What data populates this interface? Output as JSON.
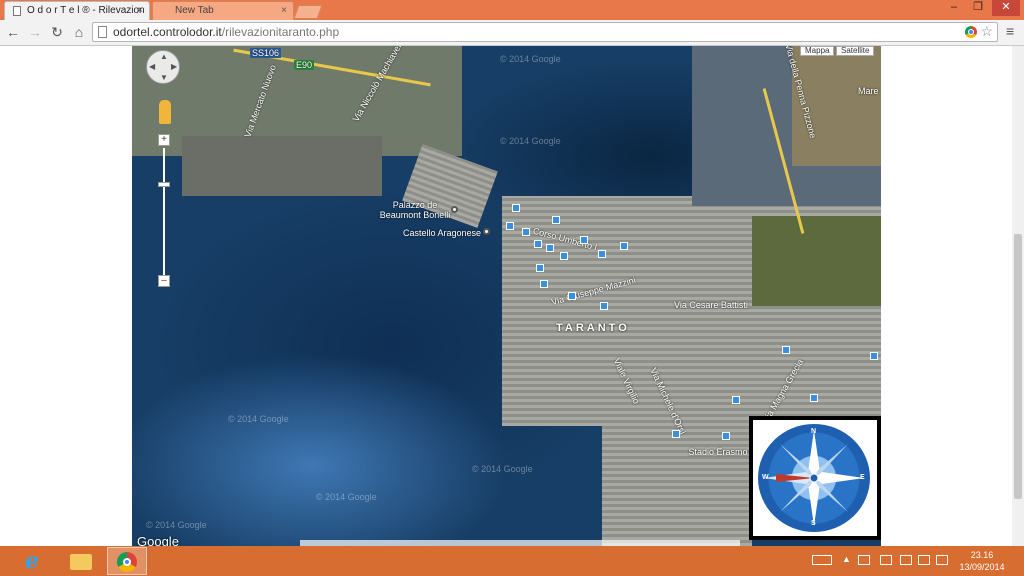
{
  "browser": {
    "tabs": [
      {
        "label": "O d o r T e l ® - Rilevazion"
      },
      {
        "label": "New Tab"
      }
    ],
    "url_host": "odortel.controlodor.it",
    "url_path": "/rilevazionitaranto.php",
    "window_controls": {
      "minimize": "–",
      "restore": "❐",
      "close": "✕"
    },
    "close_tab": "×"
  },
  "map": {
    "type_buttons": [
      "Mappa",
      "Satellite"
    ],
    "city_label": "TARANTO",
    "streets": [
      "SS106",
      "E90",
      "Via Niccolò Machiavelli",
      "Via Mercato Nuovo",
      "Corso Umberto I",
      "Via Giuseppe Mazzini",
      "Via Cesare Battisti",
      "Viale Virgilio",
      "Via Michele d'Orsi",
      "Via Magna Grecia",
      "Via della Penna Pizzone",
      "Mare"
    ],
    "pois": [
      "Palazzo de Beaumont Bonelli",
      "Castello Aragonese",
      "Stadio Erasmo"
    ],
    "watermarks": [
      "© 2014 Google",
      "© 2014 Google",
      "© 2014 Google",
      "© 2014 Google",
      "© 2014 Google",
      "© 2014 Google"
    ],
    "google_logo": "Google",
    "zoom_plus": "+",
    "zoom_minus": "–",
    "compass_labels": {
      "n": "N",
      "s": "S",
      "e": "E",
      "w": "W"
    }
  },
  "taskbar": {
    "time": "23.16",
    "date": "13/09/2014"
  }
}
